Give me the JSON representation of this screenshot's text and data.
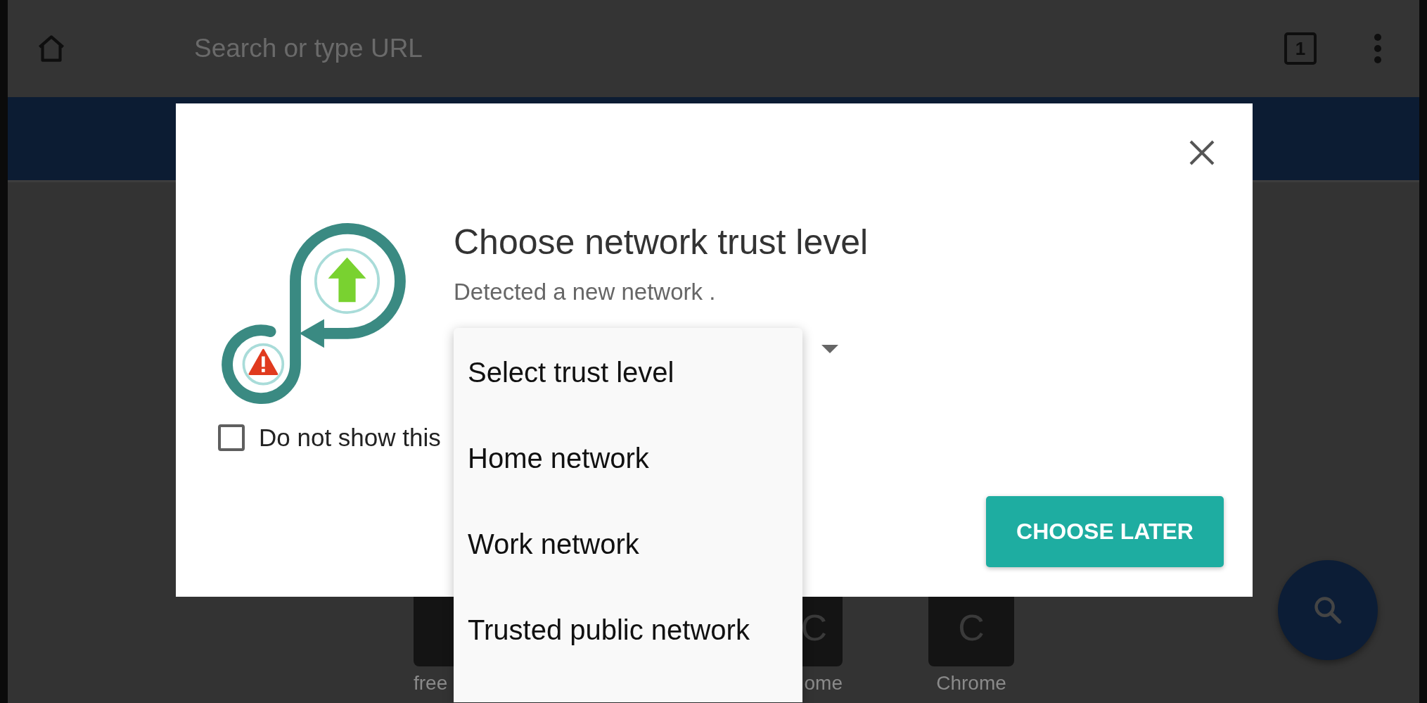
{
  "browser_bar": {
    "search": {
      "placeholder": "Search or type URL"
    },
    "tab_count": "1"
  },
  "shortcuts": [
    {
      "label": "free"
    },
    {
      "letter": "C",
      "label": "ome"
    },
    {
      "letter": "C",
      "label": "Chrome"
    }
  ],
  "dialog": {
    "title": "Choose network trust level",
    "message": "Detected a new network .",
    "checkbox": {
      "label": "Do not show this",
      "checked": false
    },
    "dropdown": {
      "expanded": true,
      "options": [
        "Select trust level",
        "Home network",
        "Work network",
        "Trusted public network"
      ]
    },
    "button": "CHOOSE LATER"
  }
}
